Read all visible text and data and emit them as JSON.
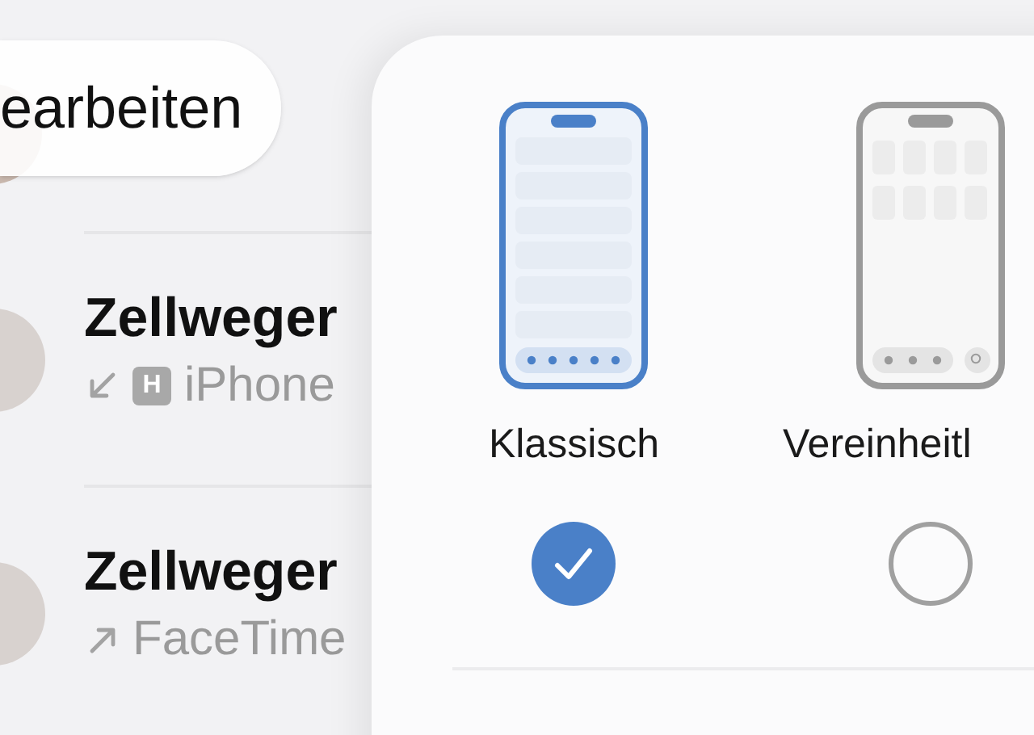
{
  "edit_button": {
    "label": "earbeiten"
  },
  "calls": [
    {
      "name": "Zellweger",
      "kind": "incoming",
      "badge": "H",
      "detail": "iPhone"
    },
    {
      "name": "Zellweger",
      "kind": "outgoing",
      "detail": "FaceTime"
    }
  ],
  "layout_options": [
    {
      "label": "Klassisch",
      "kind": "list",
      "selected": true
    },
    {
      "label": "Vereinheitl",
      "kind": "grid",
      "selected": false
    }
  ]
}
